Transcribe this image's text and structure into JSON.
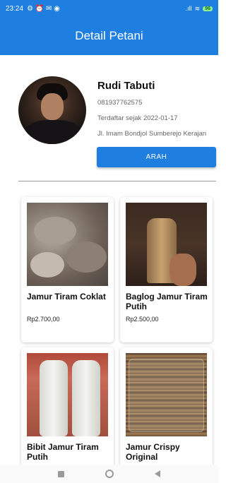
{
  "status_bar": {
    "time": "23:24",
    "left_icons": "⚙ ⏰ ✉ ◉",
    "signal": ".ıll",
    "wifi": "≋",
    "battery": "96"
  },
  "header": {
    "title": "Detail Petani"
  },
  "farmer": {
    "name": "Rudi Tabuti",
    "phone": "081937762575",
    "registered": "Terdaftar sejak 2022-01-17",
    "address": "Jl. Imam Bondjol Sumberejo Kerajan"
  },
  "actions": {
    "direction_label": "ARAH"
  },
  "products": [
    {
      "name": "Jamur Tiram Coklat",
      "price": "Rp2.700,00"
    },
    {
      "name": "Baglog Jamur Tiram Putih",
      "price": "Rp2.500,00"
    },
    {
      "name": "Bibit Jamur Tiram Putih",
      "price": ""
    },
    {
      "name": "Jamur Crispy Original",
      "price": ""
    }
  ],
  "icons": {
    "nav_recent": "square-icon",
    "nav_home": "circle-icon",
    "nav_back": "triangle-back-icon"
  },
  "colors": {
    "primary": "#1f7fe0"
  }
}
